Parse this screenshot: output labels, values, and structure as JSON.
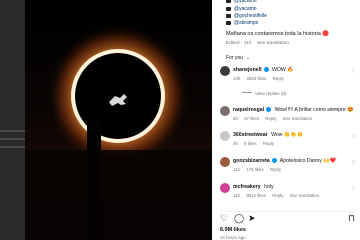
{
  "caption": {
    "lines": [
      "@yacamo",
      "@gochestifelle",
      "@sbramps"
    ],
    "text": "Mañana os contaremos toda la historia 🔴",
    "meta_time": "Edited · 11h",
    "meta_action": "See translation"
  },
  "section_label": "For you",
  "comments": [
    {
      "user": "shanejonell",
      "verified": true,
      "text": "WOW 🔥",
      "time": "14h",
      "likes": "2863 likes",
      "reply": "Reply",
      "avatar_color": "#3a3a3a"
    },
    {
      "user": "raquelrosgal",
      "verified": true,
      "text": "Wow!!!!! A brillar como siempre 😍",
      "time": "5h",
      "likes": "37 likes",
      "reply": "Reply",
      "translate": "See translation",
      "avatar_color": "#7a6f6a"
    },
    {
      "user": "360streetwear",
      "verified": false,
      "text": "Wow 👏👏👏",
      "time": "4h",
      "likes": "5 likes",
      "reply": "Reply",
      "avatar_color": "#c7c7c7"
    },
    {
      "user": "gonzsbizarreta",
      "verified": true,
      "text": "Apoteósico Danny 🙌❤️",
      "time": "11h",
      "likes": "176 likes",
      "reply": "Reply",
      "avatar_color": "#9a5a3a"
    },
    {
      "user": "mcfreakery",
      "verified": false,
      "text": "holy",
      "time": "11h",
      "likes": "3812 likes",
      "reply": "Reply",
      "translate": "See translation",
      "avatar_color": "#d43c9a"
    }
  ],
  "view_replies": "View replies (6)",
  "likes_count": "6.9M likes",
  "time_ago": "15 hours ago",
  "icons": {
    "like": "heart-icon",
    "comment": "comment-icon",
    "share": "share-icon",
    "save": "bookmark-icon"
  }
}
